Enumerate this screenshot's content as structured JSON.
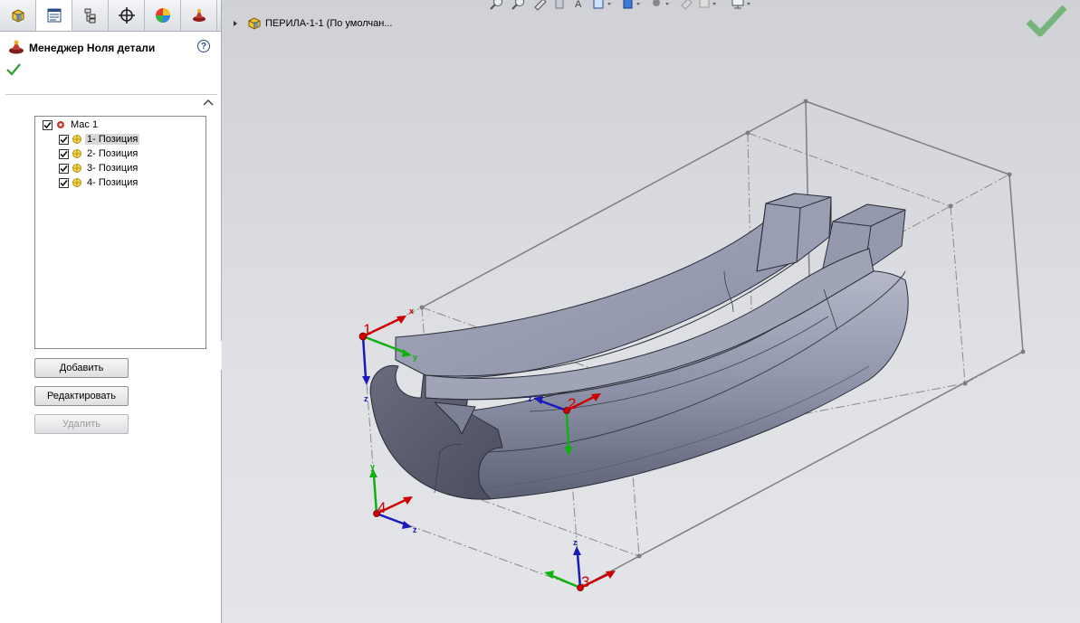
{
  "panel": {
    "tabs": [
      {
        "name": "feature-manager-tab-icon"
      },
      {
        "name": "property-manager-tab-icon"
      },
      {
        "name": "configuration-manager-tab-icon"
      },
      {
        "name": "dimxpert-manager-tab-icon"
      },
      {
        "name": "display-manager-tab-icon"
      },
      {
        "name": "mate-manager-tab-icon"
      }
    ],
    "title": "Менеджер Ноля детали",
    "help": "?",
    "tree": {
      "root": "Мас 1",
      "items": [
        "1- Позиция",
        "2- Позиция",
        "3- Позиция",
        "4- Позиция"
      ],
      "selected_index": 0
    },
    "buttons": {
      "add": "Добавить",
      "edit": "Редактировать",
      "delete": "Удалить"
    }
  },
  "viewport": {
    "breadcrumb": "ПЕРИЛА-1-1  (По умолчан...",
    "axis_labels": {
      "x": "x",
      "y": "y",
      "z": "z"
    },
    "positions": [
      {
        "num": "1"
      },
      {
        "num": "2"
      },
      {
        "num": "3"
      },
      {
        "num": "4"
      }
    ]
  },
  "colors": {
    "accent_check": "#2e9c2e",
    "axis_x": "#cc0000",
    "axis_y": "#10b010",
    "axis_z": "#1a1ab8",
    "part_face": "#8e93a8"
  }
}
